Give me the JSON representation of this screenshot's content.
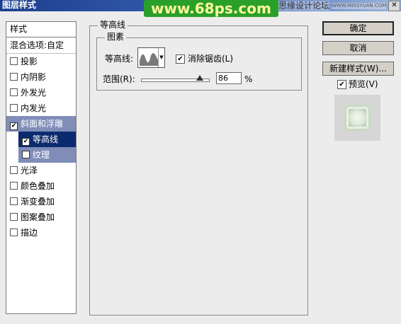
{
  "window": {
    "title": "图层样式",
    "watermark": "www.68ps.com",
    "site_name": "思缘设计论坛",
    "site_url": "WWW.MISSYUAN.COM",
    "close_label": "✕"
  },
  "styles_panel": {
    "header": "样式",
    "blend_options": "混合选项:自定",
    "items": [
      {
        "label": "投影",
        "checked": false
      },
      {
        "label": "内阴影",
        "checked": false
      },
      {
        "label": "外发光",
        "checked": false
      },
      {
        "label": "内发光",
        "checked": false
      },
      {
        "label": "斜面和浮雕",
        "checked": true
      },
      {
        "label": "等高线",
        "checked": true
      },
      {
        "label": "纹理",
        "checked": false
      },
      {
        "label": "光泽",
        "checked": false
      },
      {
        "label": "颜色叠加",
        "checked": false
      },
      {
        "label": "渐变叠加",
        "checked": false
      },
      {
        "label": "图案叠加",
        "checked": false
      },
      {
        "label": "描边",
        "checked": false
      }
    ],
    "selected": "等高线"
  },
  "contour_section": {
    "group_title": "等高线",
    "subgroup_title": "图素",
    "contour_label": "等高线:",
    "anti_alias_label": "消除锯齿(L)",
    "anti_alias_checked": true,
    "range_label": "范围(R):",
    "range_value": "86",
    "range_unit": "%",
    "range_fraction": 0.86
  },
  "buttons": {
    "ok": "确定",
    "cancel": "取消",
    "new_style": "新建样式(W)...",
    "preview_label": "预览(V)",
    "preview_checked": true
  },
  "colors": {
    "selected_item_bg": "#0c2a6e",
    "highlight_item_bg": "#7f8db8",
    "title_bar": "#1b3f8c",
    "watermark_bg": "#2aa02a"
  }
}
